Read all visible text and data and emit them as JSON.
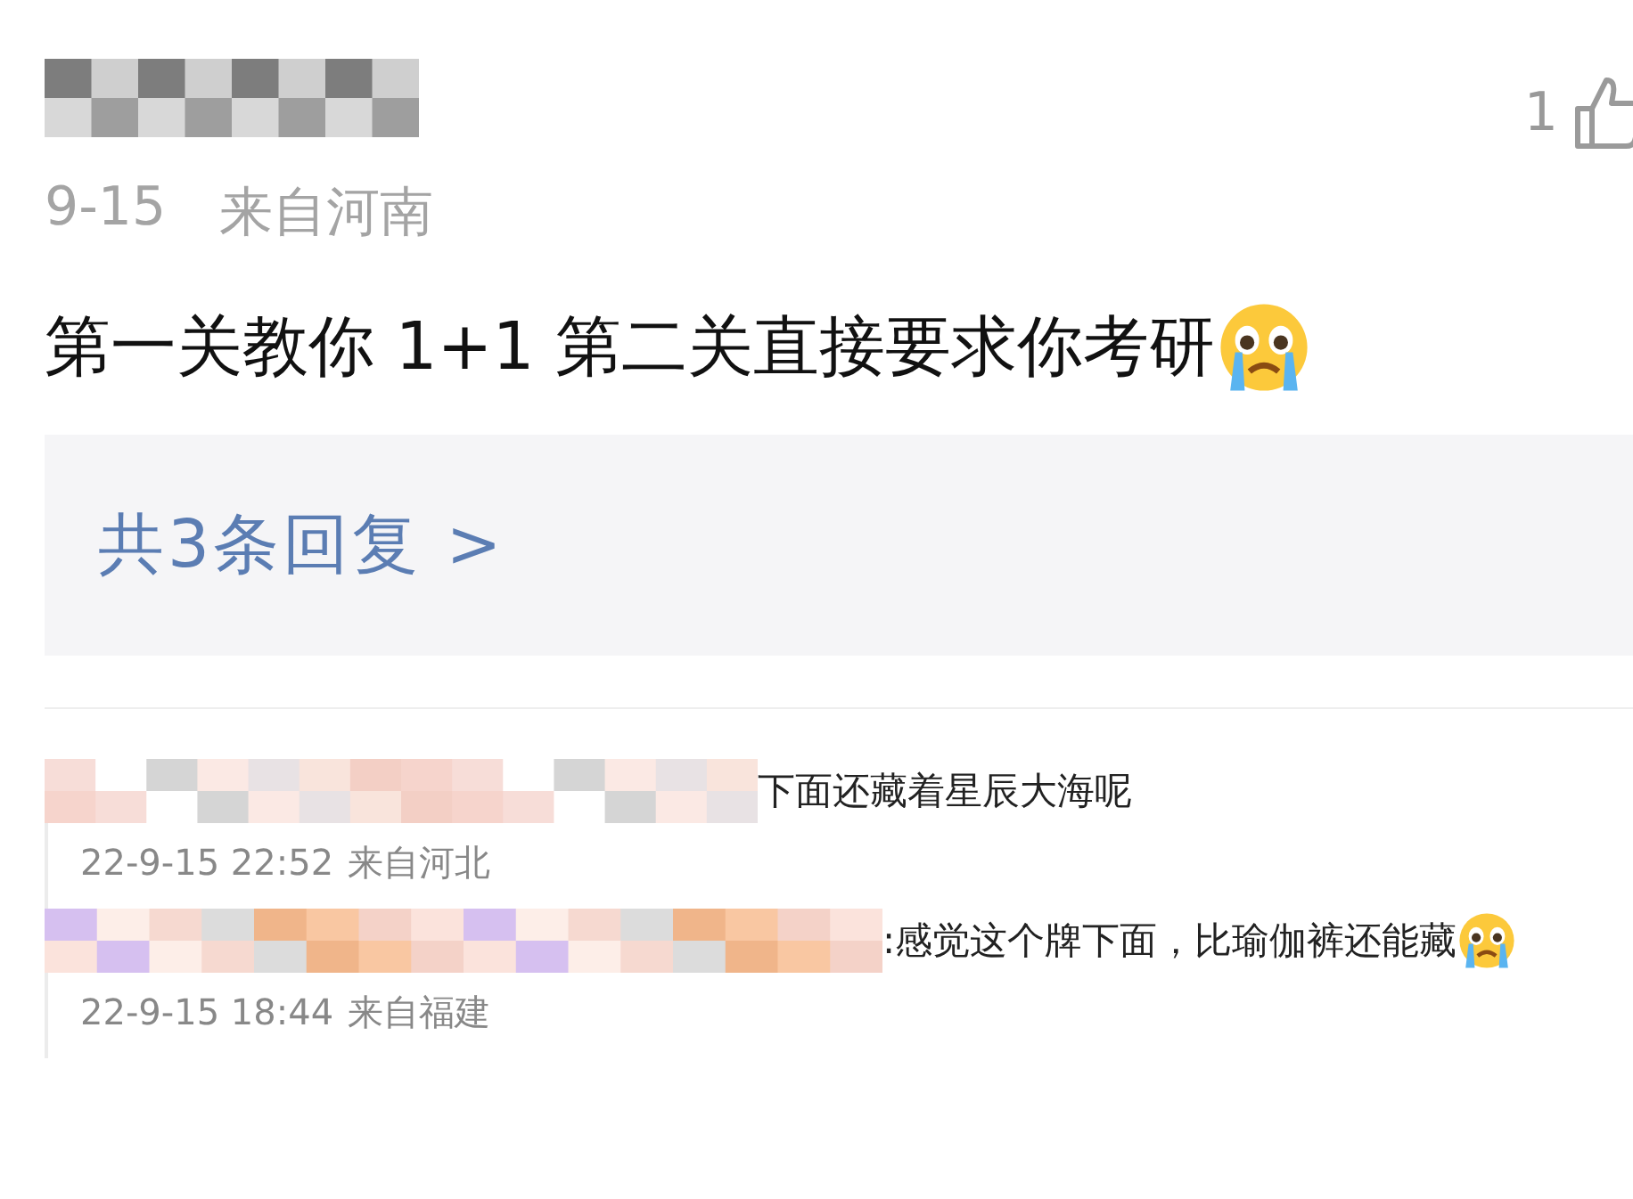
{
  "comment": {
    "likes": "1",
    "date": "9-15",
    "location": "来自河南",
    "text": "第一关教你 1+1 第二关直接要求你考研",
    "reply_link": "共3条回复 >"
  },
  "replies": [
    {
      "text": "下面还藏着星辰大海呢",
      "emoji": false,
      "date": "22-9-15 22:52",
      "location": "来自河北"
    },
    {
      "text": ":感觉这个牌下面，比瑜伽裤还能藏",
      "emoji": true,
      "date": "22-9-15 18:44",
      "location": "来自福建"
    }
  ]
}
